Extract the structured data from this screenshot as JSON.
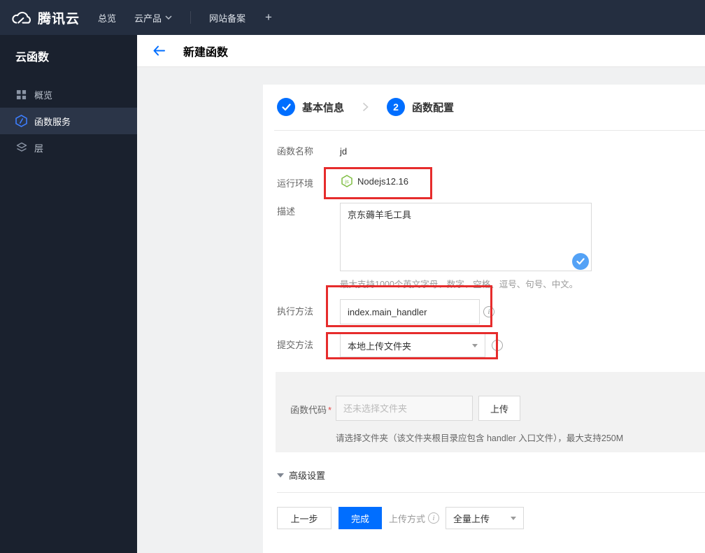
{
  "topbar": {
    "brand": "腾讯云",
    "nav_overview": "总览",
    "nav_products": "云产品",
    "nav_beian": "网站备案",
    "nav_plus": "+"
  },
  "sidebar": {
    "title": "云函数",
    "items": [
      {
        "label": "概览"
      },
      {
        "label": "函数服务"
      },
      {
        "label": "层"
      }
    ]
  },
  "header": {
    "title": "新建函数"
  },
  "steps": {
    "step1": {
      "label": "基本信息"
    },
    "step2": {
      "number": "2",
      "label": "函数配置"
    }
  },
  "form": {
    "name": {
      "label": "函数名称",
      "value": "jd"
    },
    "runtime": {
      "label": "运行环境",
      "value": "Nodejs12.16"
    },
    "description": {
      "label": "描述",
      "value": "京东薅羊毛工具",
      "hint": "最大支持1000个英文字母、数字、空格、逗号、句号、中文。"
    },
    "handler": {
      "label": "执行方法",
      "value": "index.main_handler"
    },
    "submit": {
      "label": "提交方法",
      "value": "本地上传文件夹"
    },
    "code": {
      "label": "函数代码",
      "required_mark": "*",
      "placeholder": "还未选择文件夹",
      "upload_button": "上传",
      "hint": "请选择文件夹（该文件夹根目录应包含 handler 入口文件），最大支持250M"
    },
    "advanced_label": "高级设置"
  },
  "footer": {
    "prev_button": "上一步",
    "finish_button": "完成",
    "upload_mode_label": "上传方式",
    "upload_mode_value": "全量上传"
  },
  "colors": {
    "accent_blue": "#006eff",
    "light_blue_check": "#54a2f6",
    "annotation_red": "#e62c2c",
    "node_green": "#7fbe42",
    "topbar_bg": "#242e40",
    "sidebar_bg": "#1a212e"
  }
}
